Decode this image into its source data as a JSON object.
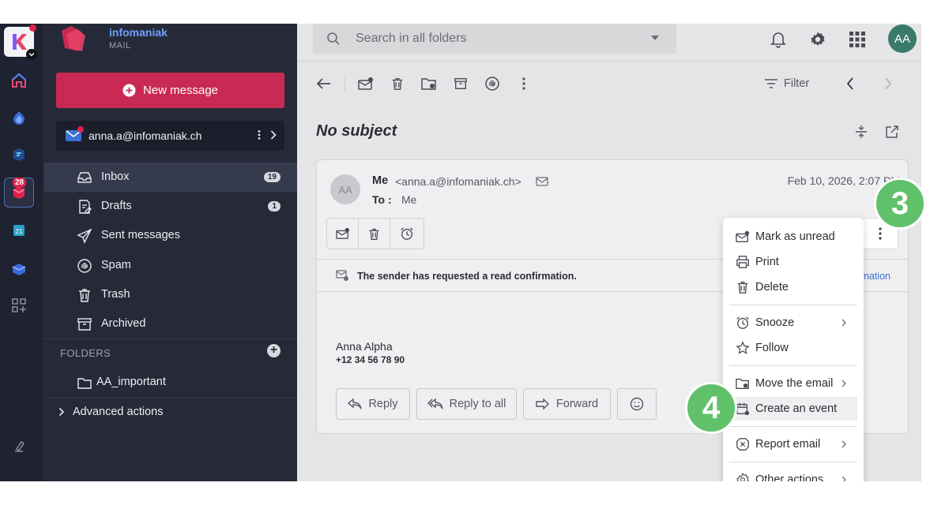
{
  "rail": {
    "unread_badge": "28"
  },
  "brand": {
    "name": "infomaniak",
    "product": "MAIL"
  },
  "sidebar": {
    "new_message_label": "New message",
    "account_email": "anna.a@infomaniak.ch",
    "folders": [
      {
        "label": "Inbox",
        "count": "19",
        "icon": "inbox-icon"
      },
      {
        "label": "Drafts",
        "count": "1",
        "icon": "draft-icon"
      },
      {
        "label": "Sent messages",
        "count": "",
        "icon": "send-icon"
      },
      {
        "label": "Spam",
        "count": "",
        "icon": "spam-hand-icon"
      },
      {
        "label": "Trash",
        "count": "",
        "icon": "trash-icon"
      },
      {
        "label": "Archived",
        "count": "",
        "icon": "archive-icon"
      }
    ],
    "folders_section_title": "FOLDERS",
    "custom_folder": "AA_important",
    "advanced_actions": "Advanced actions"
  },
  "header": {
    "search_placeholder": "Search in all folders",
    "avatar_initials": "AA"
  },
  "toolbar": {
    "filter_label": "Filter"
  },
  "message": {
    "subject": "No subject",
    "avatar_initials": "AA",
    "from_name": "Me",
    "from_address": "<anna.a@infomaniak.ch>",
    "to_label": "To :",
    "to_value": "Me",
    "date": "Feb 10, 2026, 2:07 PM",
    "read_confirmation_notice": "The sender has requested a read confirmation.",
    "read_confirmation_link": "mation",
    "signature_name": "Anna Alpha",
    "signature_phone": "+12 34 56 78 90",
    "reply_label": "Reply",
    "reply_all_label": "Reply to all",
    "forward_label": "Forward"
  },
  "menu": {
    "items": [
      {
        "label": "Mark as unread",
        "icon": "mail-unread-icon"
      },
      {
        "label": "Print",
        "icon": "printer-icon"
      },
      {
        "label": "Delete",
        "icon": "trash-icon"
      },
      {
        "label": "Snooze",
        "icon": "alarm-clock-icon"
      },
      {
        "label": "Follow",
        "icon": "star-icon"
      },
      {
        "label": "Move the email",
        "icon": "folder-move-icon"
      },
      {
        "label": "Create an event",
        "icon": "calendar-add-icon"
      },
      {
        "label": "Report email",
        "icon": "report-icon"
      },
      {
        "label": "Other actions",
        "icon": "gear-icon"
      }
    ]
  },
  "steps": {
    "step3": "3",
    "step4": "4"
  },
  "colors": {
    "accent": "#c92a53",
    "sidebar_bg": "#262a38",
    "rail_bg": "#1f2230",
    "step_marker": "#61c16a",
    "link": "#3a73d9"
  }
}
